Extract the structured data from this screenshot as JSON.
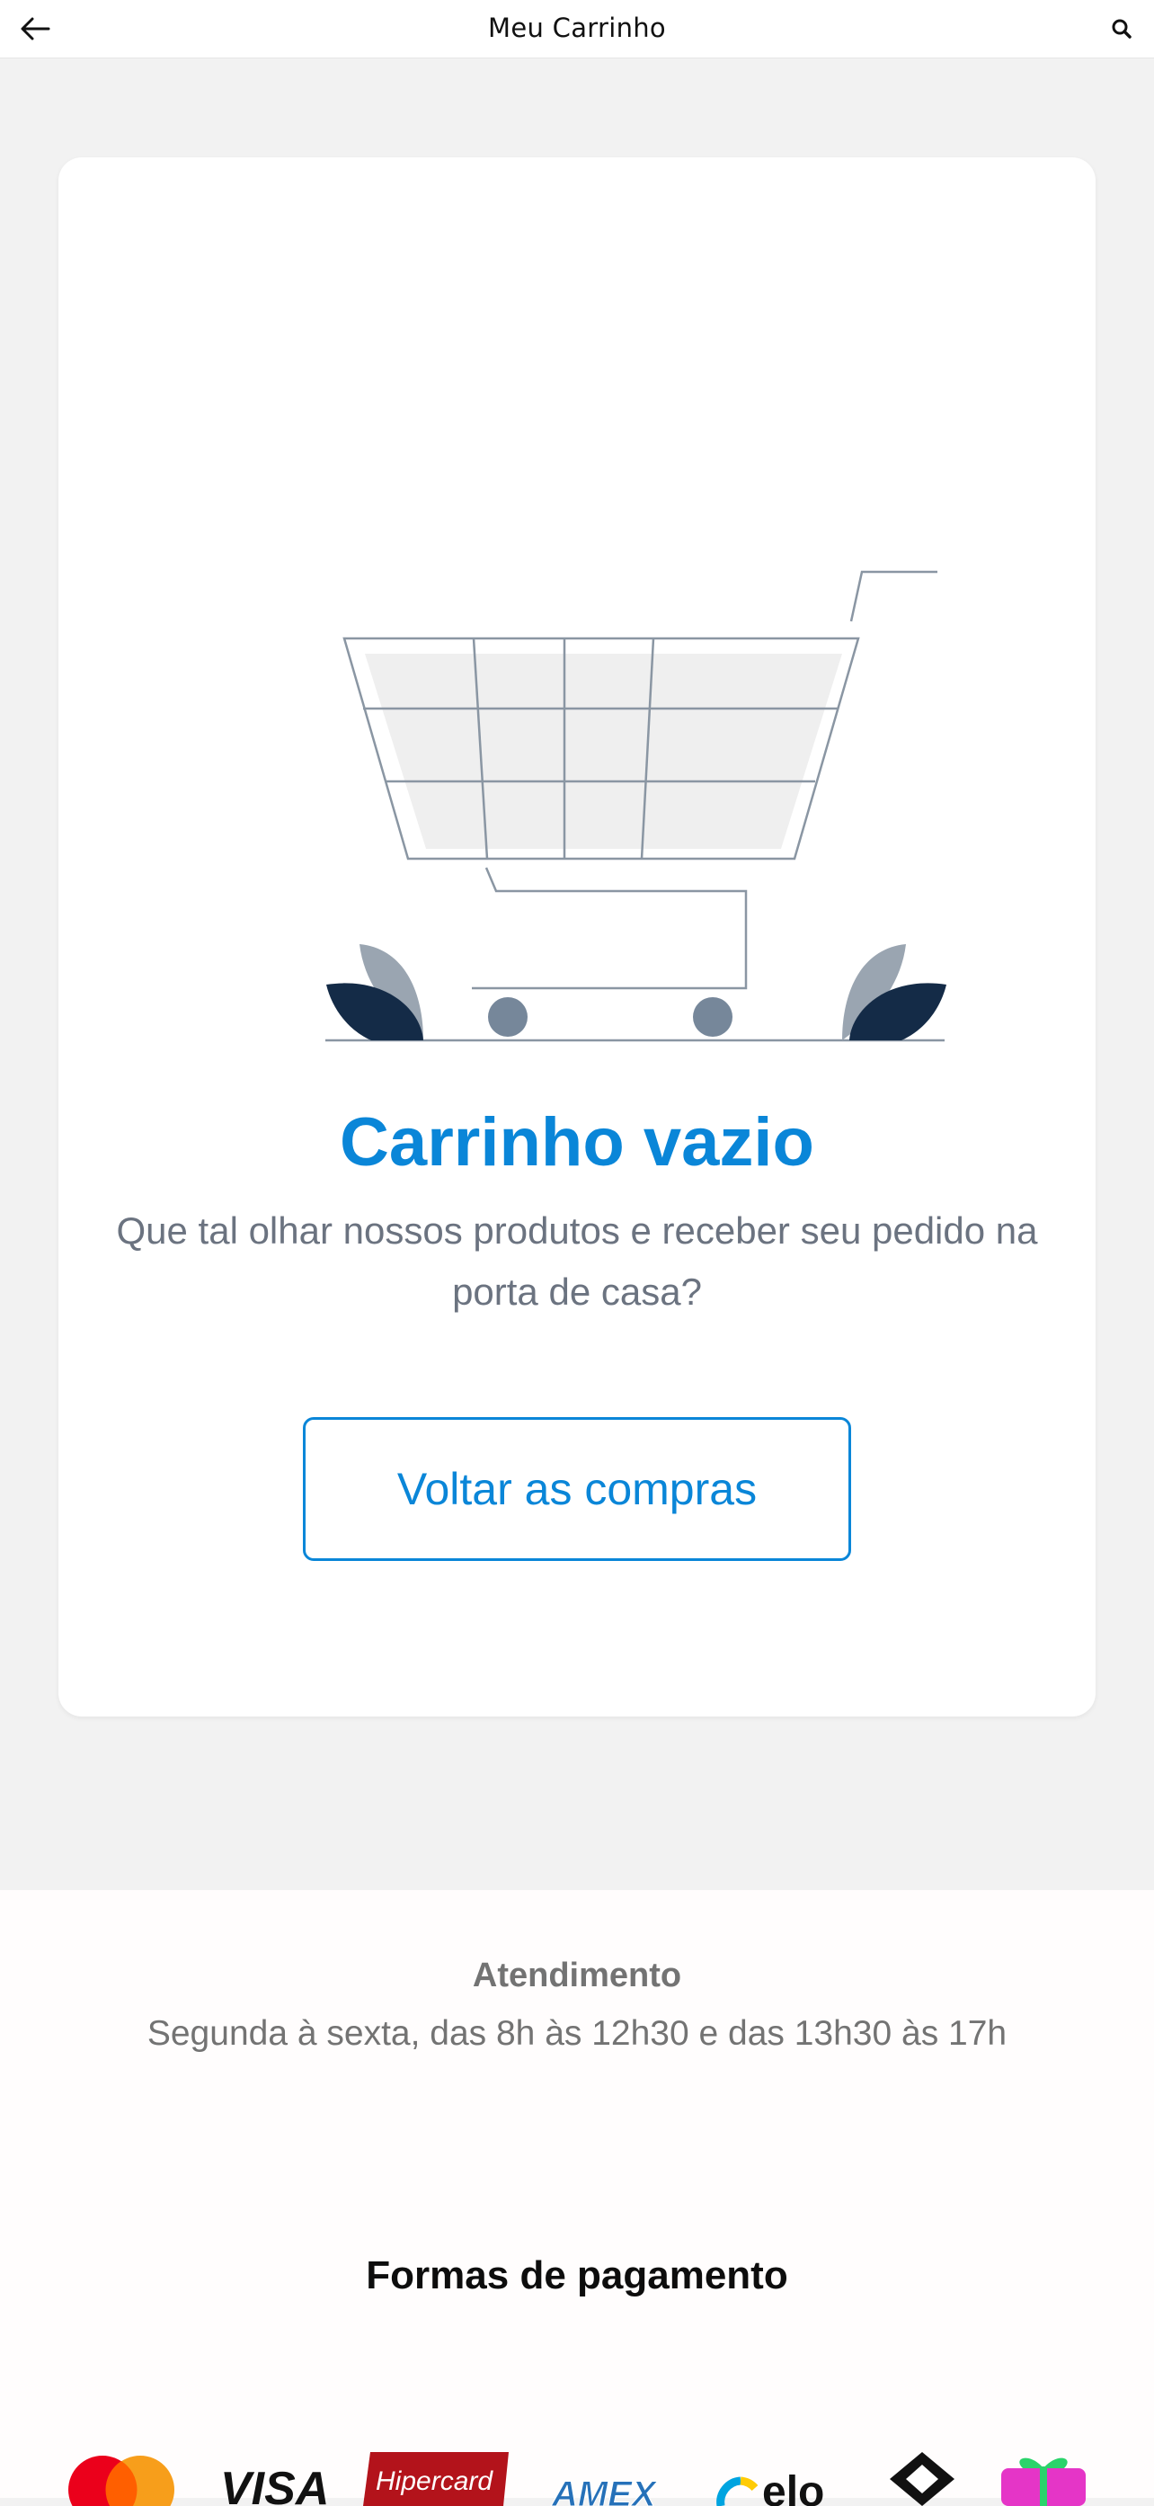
{
  "header": {
    "title": "Meu Carrinho",
    "back_icon": "arrow-left-icon",
    "search_icon": "search-icon"
  },
  "empty_cart": {
    "illustration": "empty-shopping-cart-illustration",
    "title": "Carrinho vazio",
    "subtitle": "Que tal olhar nossos produtos e receber seu pedido na porta de casa?",
    "button_label": "Voltar as compras"
  },
  "footer": {
    "support_title": "Atendimento",
    "support_hours": "Segunda à sexta, das 8h às 12h30 e das 13h30 às 17h",
    "payments_title": "Formas de pagamento",
    "payment_logos": [
      {
        "name": "mastercard-logo"
      },
      {
        "name": "visa-logo",
        "text": "VISA"
      },
      {
        "name": "hipercard-logo",
        "text": "Hipercard"
      },
      {
        "name": "amex-logo",
        "text": "AMEX"
      },
      {
        "name": "elo-logo",
        "text": "elo"
      },
      {
        "name": "diners-logo"
      },
      {
        "name": "gift-card-logo"
      }
    ]
  },
  "colors": {
    "accent": "#0a86d8",
    "text_muted": "#6b7380",
    "illustration_dark": "#142b47",
    "illustration_gray": "#9aa5b1"
  }
}
